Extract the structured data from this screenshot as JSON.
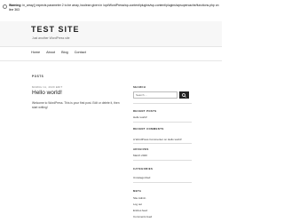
{
  "warning": {
    "label": "Warning",
    "message": ": in_array() expects parameter 2 to be array, boolean given in /opt/WordPress/wp-content/plugins/wp-content/plugins/wpsupercache/functions.php on line 363",
    "line_label": "363"
  },
  "site": {
    "title": "TEST SITE",
    "description": "Just another WordPress site"
  },
  "nav": {
    "items": [
      "Home",
      "About",
      "Blog",
      "Contact"
    ]
  },
  "main": {
    "section_label": "POSTS",
    "post": {
      "date": "MARCH 11, 2020 EDIT",
      "title": "Hello world!",
      "body": "Welcome to WordPress. This is your first post. Edit or delete it, then start writing!"
    }
  },
  "sidebar": {
    "search": {
      "title": "SEARCH",
      "placeholder": "Search …"
    },
    "recent_posts": {
      "title": "RECENT POSTS",
      "items": [
        "Hello world!"
      ]
    },
    "recent_comments": {
      "title": "RECENT COMMENTS",
      "items": [
        "A WordPress Commenter on Hello world!"
      ]
    },
    "archives": {
      "title": "ARCHIVES",
      "items": [
        "March 2020"
      ]
    },
    "categories": {
      "title": "CATEGORIES",
      "items": [
        "Uncategorized"
      ]
    },
    "meta": {
      "title": "META",
      "items": [
        "Site Admin",
        "Log out",
        "Entries feed",
        "Comments feed"
      ]
    }
  }
}
